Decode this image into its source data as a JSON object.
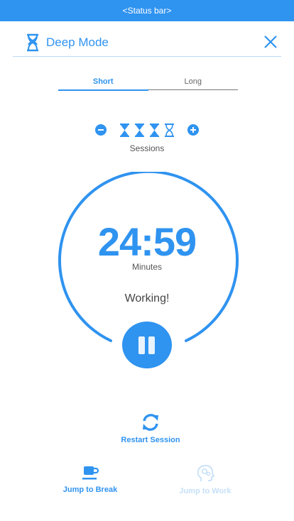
{
  "status_bar": {
    "text": "<Status bar>"
  },
  "header": {
    "title": "Deep Mode",
    "mode_icon": "hourglass-icon",
    "close_icon": "close-icon"
  },
  "tabs": [
    {
      "label": "Short",
      "active": true
    },
    {
      "label": "Long",
      "active": false
    }
  ],
  "sessions": {
    "label": "Sessions",
    "total": 4,
    "filled": 3,
    "decrement_icon": "minus-icon",
    "increment_icon": "plus-icon"
  },
  "timer": {
    "time": "24:59",
    "unit": "Minutes",
    "state": "Working!"
  },
  "controls": {
    "pause_icon": "pause-icon"
  },
  "restart": {
    "label": "Restart Session",
    "icon": "refresh-icon"
  },
  "jump": {
    "break_label": "Jump to Break",
    "break_icon": "coffee-cup-icon",
    "work_label": "Jump to Work",
    "work_icon": "head-gears-icon"
  },
  "colors": {
    "accent": "#2f93f0",
    "disabled": "#c6e0f8"
  }
}
